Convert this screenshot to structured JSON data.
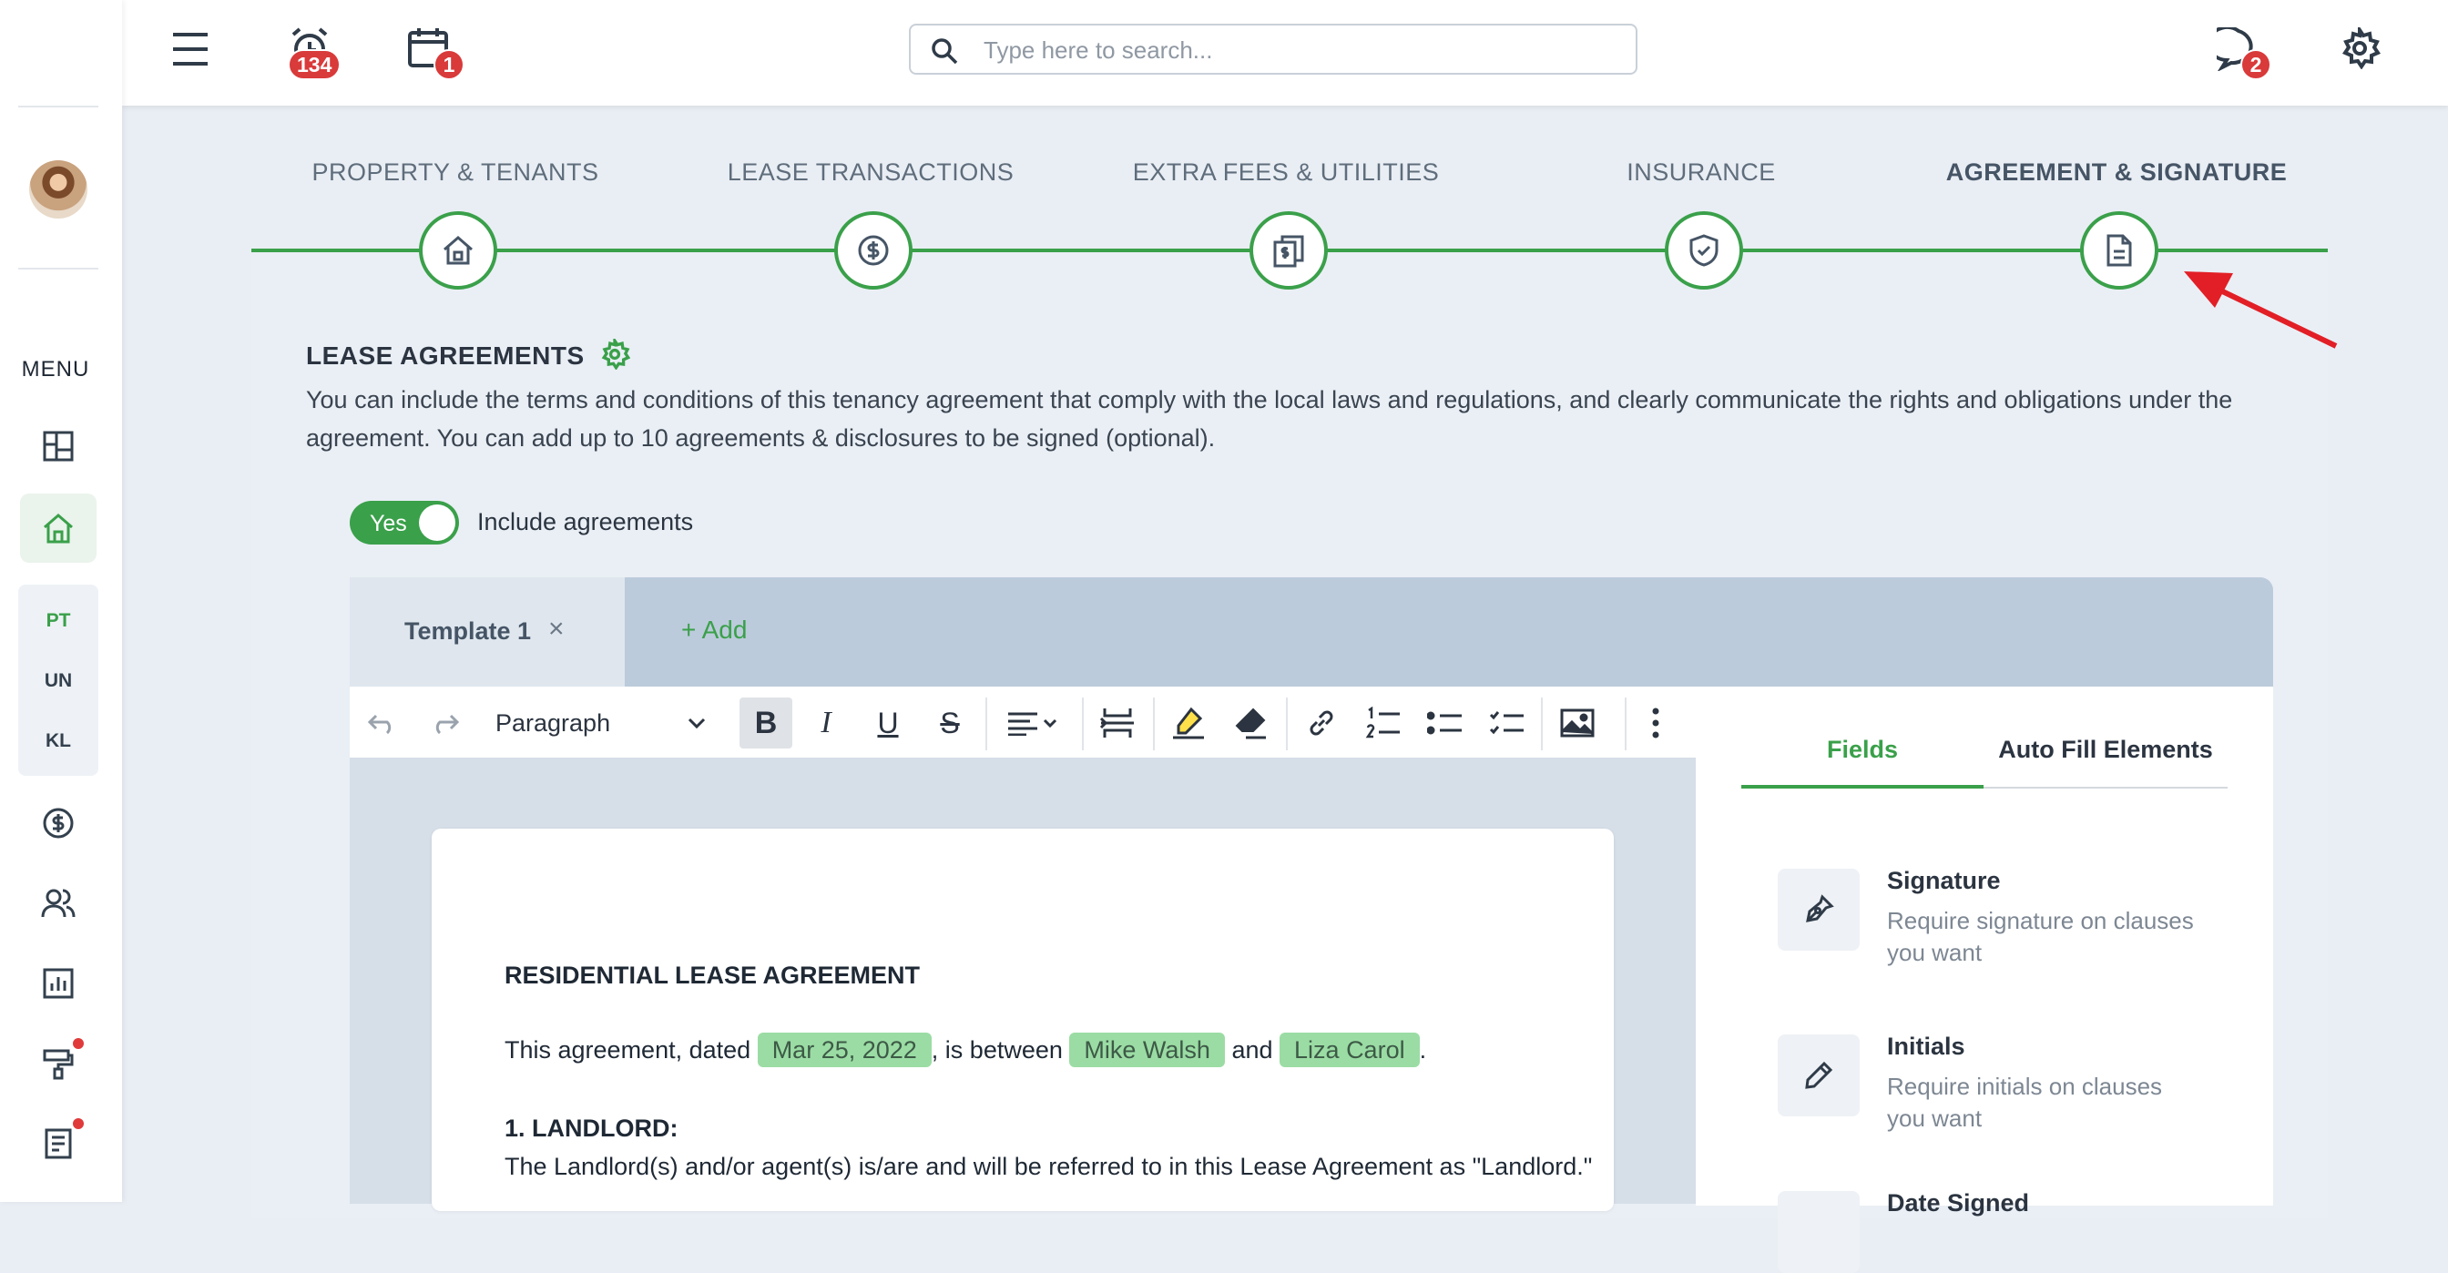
{
  "header": {
    "notifications_count": "134",
    "calendar_count": "1",
    "messages_count": "2",
    "search_placeholder": "Type here to search..."
  },
  "sidebar": {
    "menu_label": "MENU",
    "codes": [
      "PT",
      "UN",
      "KL"
    ]
  },
  "stepper": {
    "steps": [
      {
        "label": "PROPERTY & TENANTS",
        "icon": "home-icon"
      },
      {
        "label": "LEASE TRANSACTIONS",
        "icon": "dollar-icon"
      },
      {
        "label": "EXTRA FEES & UTILITIES",
        "icon": "bills-icon"
      },
      {
        "label": "INSURANCE",
        "icon": "shield-icon"
      },
      {
        "label": "AGREEMENT & SIGNATURE",
        "icon": "document-icon"
      }
    ],
    "active_index": 4
  },
  "section": {
    "title": "LEASE AGREEMENTS",
    "description": "You can include the terms and conditions of this tenancy agreement that comply with the local laws and regulations, and clearly communicate the rights and obligations under the agreement. You can add up to 10 agreements & disclosures to be signed (optional).",
    "toggle_label": "Yes",
    "toggle_text": "Include agreements"
  },
  "tabs": {
    "active": "Template 1",
    "close": "×",
    "add": "+ Add"
  },
  "editor": {
    "paragraph_style": "Paragraph",
    "doc_title": "RESIDENTIAL LEASE AGREEMENT",
    "line1_pre": "This agreement, dated",
    "date": "Mar 25, 2022",
    "line1_mid": ", is between",
    "party1": "Mike Walsh",
    "line1_and": "and",
    "party2": "Liza Carol",
    "line1_end": ".",
    "heading1": "1. LANDLORD:",
    "landlord_text": "The Landlord(s) and/or agent(s) is/are and will be referred to in this Lease Agreement as \"Landlord.\""
  },
  "panel": {
    "tab_fields": "Fields",
    "tab_autofill": "Auto Fill Elements",
    "fields": [
      {
        "title": "Signature",
        "desc": "Require signature on clauses you want"
      },
      {
        "title": "Initials",
        "desc": "Require initials on clauses you want"
      },
      {
        "title": "Date Signed",
        "desc": ""
      }
    ]
  },
  "colors": {
    "accent": "#3aa04a",
    "badge": "#d93a3a",
    "chip": "#9bdca4"
  }
}
